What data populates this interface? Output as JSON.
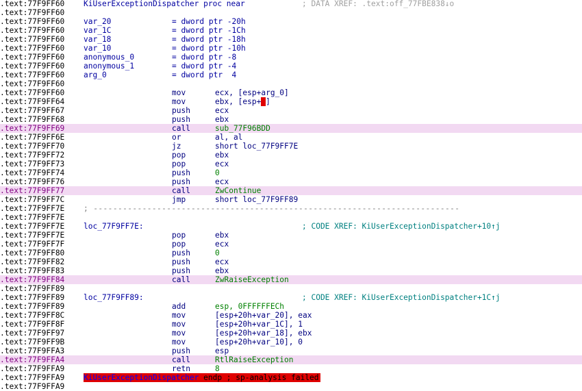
{
  "lines": [
    {
      "addr": ".text:77F9FF60",
      "label": "KiUserExceptionDispatcher proc near",
      "xref": "; DATA XREF: .text:off_77FBE838↓o",
      "xref_kind": "data"
    },
    {
      "addr": ".text:77F9FF60"
    },
    {
      "addr": ".text:77F9FF60",
      "label": "var_20",
      "eq": "= dword ptr -20h"
    },
    {
      "addr": ".text:77F9FF60",
      "label": "var_1C",
      "eq": "= dword ptr -1Ch"
    },
    {
      "addr": ".text:77F9FF60",
      "label": "var_18",
      "eq": "= dword ptr -18h"
    },
    {
      "addr": ".text:77F9FF60",
      "label": "var_10",
      "eq": "= dword ptr -10h"
    },
    {
      "addr": ".text:77F9FF60",
      "label": "anonymous_0",
      "eq": "= dword ptr -8"
    },
    {
      "addr": ".text:77F9FF60",
      "label": "anonymous_1",
      "eq": "= dword ptr -4"
    },
    {
      "addr": ".text:77F9FF60",
      "label": "arg_0",
      "eq": "= dword ptr  4"
    },
    {
      "addr": ".text:77F9FF60"
    },
    {
      "addr": ".text:77F9FF60",
      "mnem": "mov",
      "op": "ecx, [esp+arg_0]"
    },
    {
      "addr": ".text:77F9FF64",
      "mnem": "mov",
      "op_pre": "ebx, [esp+",
      "op_hl": "0",
      "op_post": "]"
    },
    {
      "addr": ".text:77F9FF67",
      "mnem": "push",
      "op": "ecx"
    },
    {
      "addr": ".text:77F9FF68",
      "mnem": "push",
      "op": "ebx"
    },
    {
      "addr": ".text:77F9FF69",
      "mnem": "call",
      "op": "sub_77F96BDD",
      "call": true
    },
    {
      "addr": ".text:77F9FF6E",
      "mnem": "or",
      "op": "al, al"
    },
    {
      "addr": ".text:77F9FF70",
      "mnem": "jz",
      "op": "short loc_77F9FF7E"
    },
    {
      "addr": ".text:77F9FF72",
      "mnem": "pop",
      "op": "ebx"
    },
    {
      "addr": ".text:77F9FF73",
      "mnem": "pop",
      "op": "ecx"
    },
    {
      "addr": ".text:77F9FF74",
      "mnem": "push",
      "op": "0",
      "op_num": true
    },
    {
      "addr": ".text:77F9FF76",
      "mnem": "push",
      "op": "ecx"
    },
    {
      "addr": ".text:77F9FF77",
      "mnem": "call",
      "op": "ZwContinue",
      "call": true
    },
    {
      "addr": ".text:77F9FF7C",
      "mnem": "jmp",
      "op": "short loc_77F9FF89"
    },
    {
      "addr": ".text:77F9FF7E",
      "sep": "; ---------------------------------------------------------------------------"
    },
    {
      "addr": ".text:77F9FF7E"
    },
    {
      "addr": ".text:77F9FF7E",
      "label": "loc_77F9FF7E:",
      "xref": "; CODE XREF: KiUserExceptionDispatcher+10↑j",
      "xref_kind": "code"
    },
    {
      "addr": ".text:77F9FF7E",
      "mnem": "pop",
      "op": "ebx"
    },
    {
      "addr": ".text:77F9FF7F",
      "mnem": "pop",
      "op": "ecx"
    },
    {
      "addr": ".text:77F9FF80",
      "mnem": "push",
      "op": "0",
      "op_num": true
    },
    {
      "addr": ".text:77F9FF82",
      "mnem": "push",
      "op": "ecx"
    },
    {
      "addr": ".text:77F9FF83",
      "mnem": "push",
      "op": "ebx"
    },
    {
      "addr": ".text:77F9FF84",
      "mnem": "call",
      "op": "ZwRaiseException",
      "call": true
    },
    {
      "addr": ".text:77F9FF89"
    },
    {
      "addr": ".text:77F9FF89",
      "label": "loc_77F9FF89:",
      "xref": "; CODE XREF: KiUserExceptionDispatcher+1C↑j",
      "xref_kind": "code"
    },
    {
      "addr": ".text:77F9FF89",
      "mnem": "add",
      "op": "esp, 0FFFFFFECh",
      "op_num": true
    },
    {
      "addr": ".text:77F9FF8C",
      "mnem": "mov",
      "op": "[esp+20h+var_20], eax"
    },
    {
      "addr": ".text:77F9FF8F",
      "mnem": "mov",
      "op": "[esp+20h+var_1C], 1"
    },
    {
      "addr": ".text:77F9FF97",
      "mnem": "mov",
      "op": "[esp+20h+var_18], ebx"
    },
    {
      "addr": ".text:77F9FF9B",
      "mnem": "mov",
      "op": "[esp+20h+var_10], 0"
    },
    {
      "addr": ".text:77F9FFA3",
      "mnem": "push",
      "op": "esp"
    },
    {
      "addr": ".text:77F9FFA4",
      "mnem": "call",
      "op": "RtlRaiseException",
      "call": true
    },
    {
      "addr": ".text:77F9FFA9",
      "mnem": "retn",
      "op": "8",
      "op_num": true
    },
    {
      "addr": ".text:77F9FFA9",
      "endp_name": "KiUserExceptionDispatcher",
      "endp_rest": " endp ; sp-analysis failed"
    }
  ],
  "partial_last_line": ".text:77F9FFA9"
}
